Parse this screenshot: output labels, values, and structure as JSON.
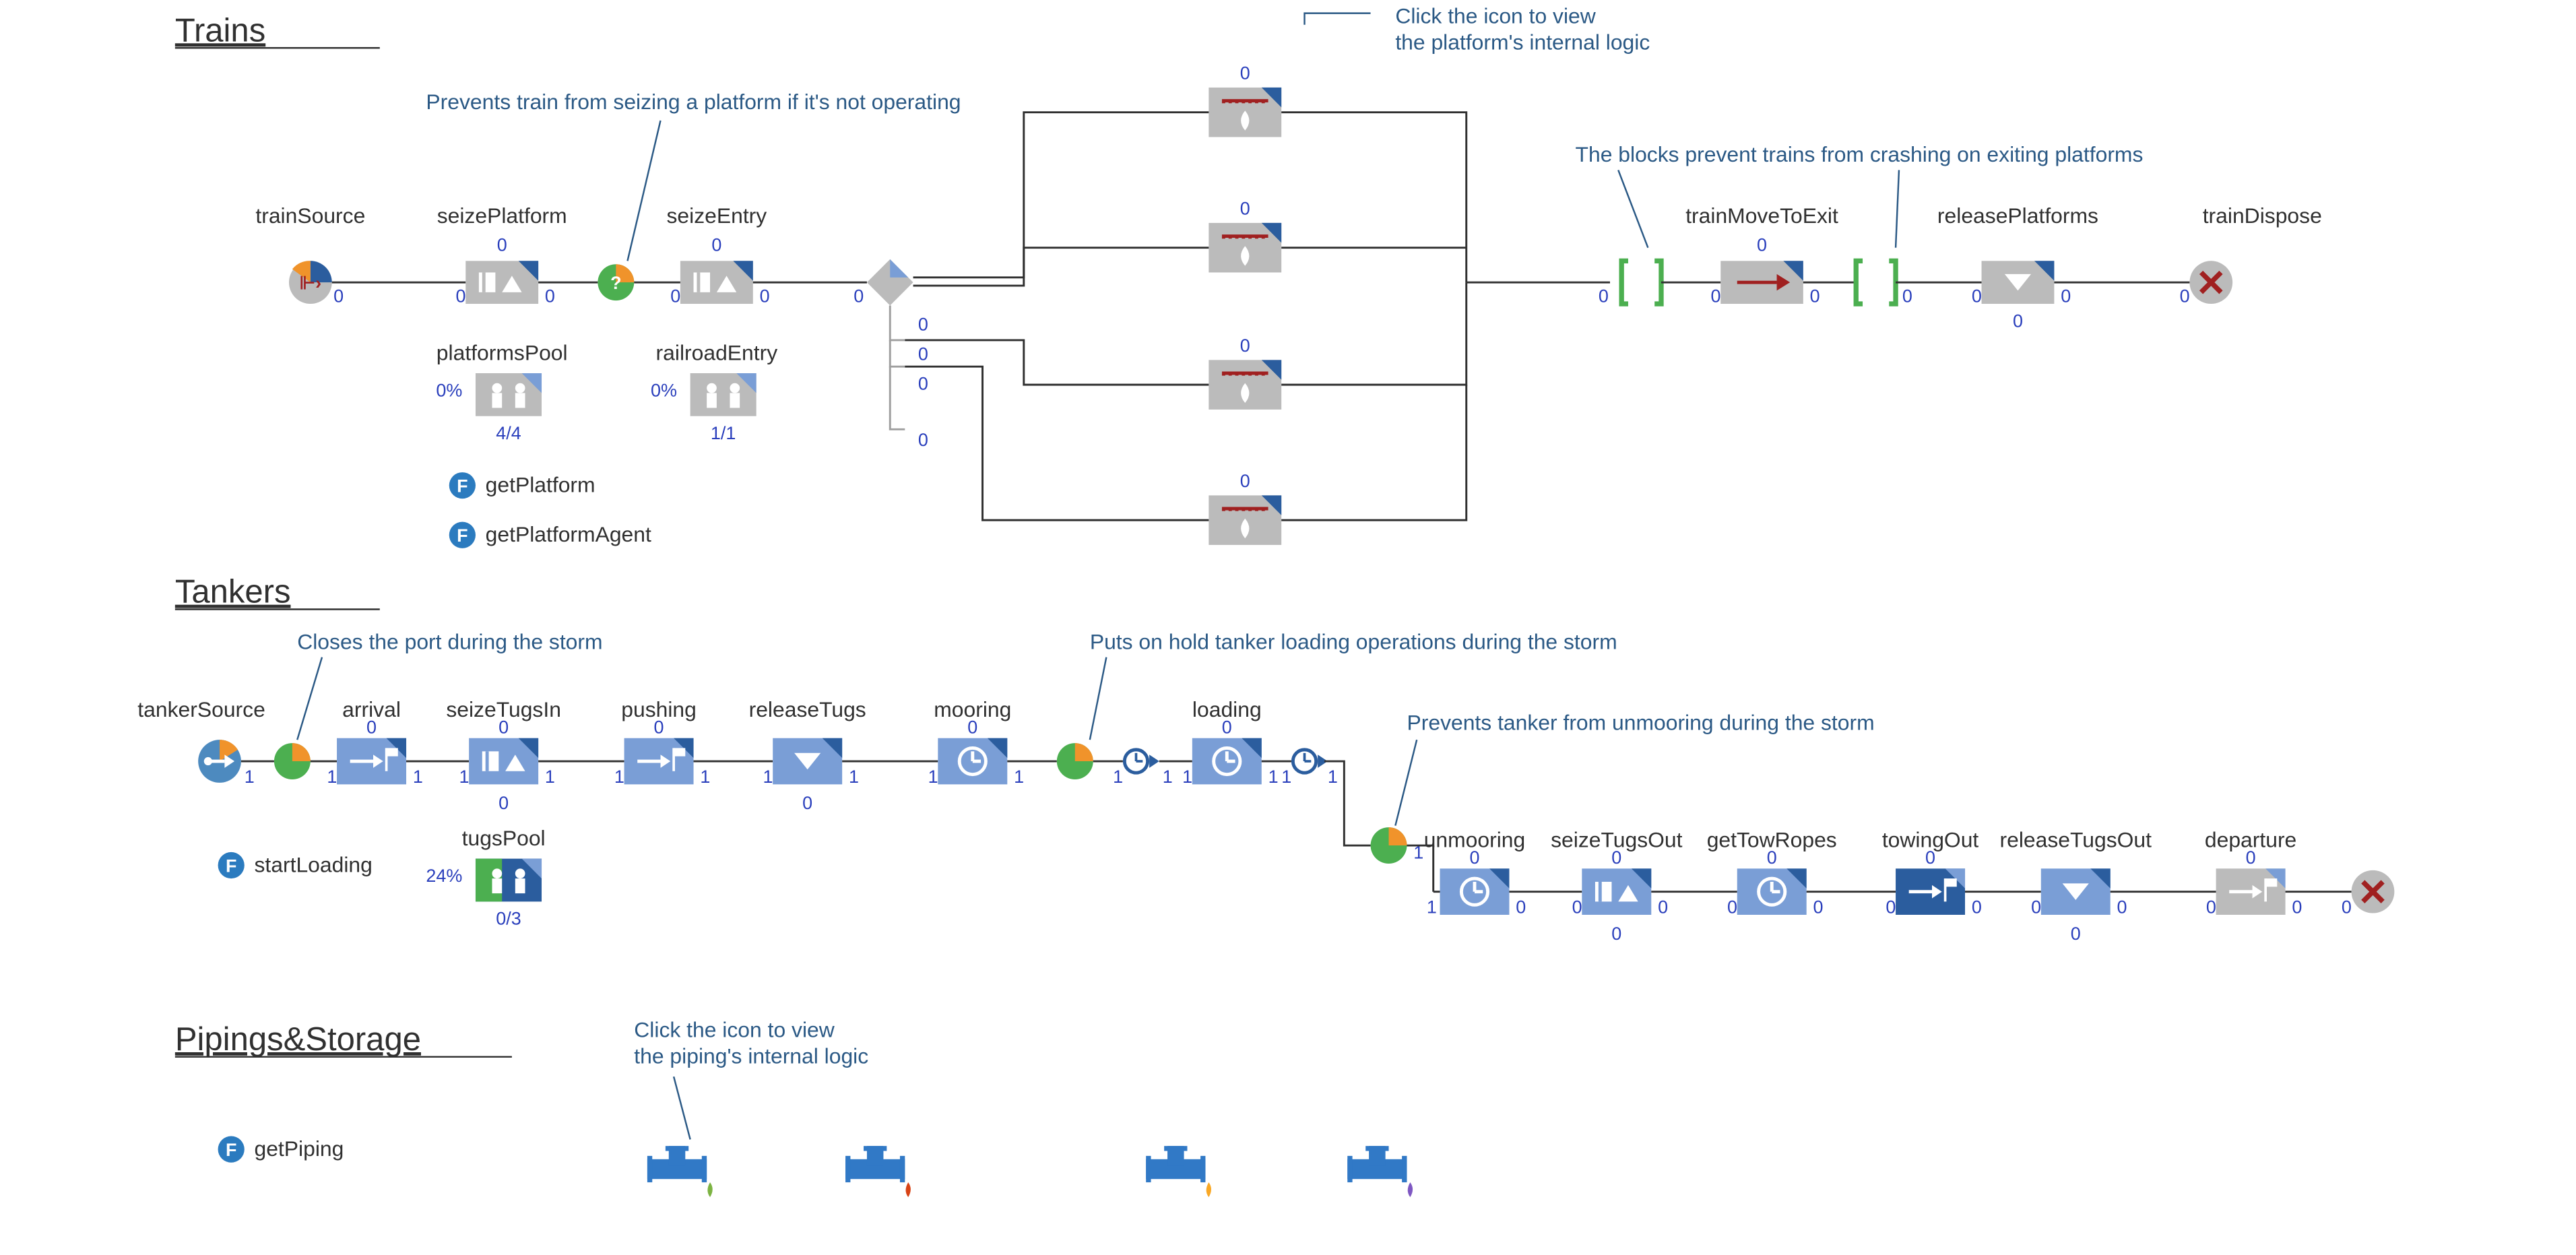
{
  "sections": {
    "trains": "Trains",
    "tankers": "Tankers",
    "pipings": "Pipings&Storage"
  },
  "notes": {
    "platformNote1": "Click the icon to view",
    "platformNote2": "the platform's internal logic",
    "preventPlatform": "Prevents train from seizing a platform if it's not operating",
    "blocksPrevent": "The blocks prevent trains from crashing on exiting platforms",
    "closesPort": "Closes the port during the storm",
    "putsOnHold": "Puts on hold tanker loading operations during the storm",
    "preventsUnmoor": "Prevents tanker from unmooring during the storm",
    "pipingNote1": "Click the icon to view",
    "pipingNote2": "the piping's internal logic"
  },
  "trains": {
    "source": {
      "label": "trainSource",
      "out": "0"
    },
    "seizePlatform": {
      "label": "seizePlatform",
      "top": "0",
      "in": "0",
      "out": "0"
    },
    "seizeEntry": {
      "label": "seizeEntry",
      "top": "0",
      "in": "0",
      "out": "0"
    },
    "selectOut": {
      "in": "0",
      "o1": "0",
      "o2": "0",
      "o3": "0",
      "o4": "0"
    },
    "platforms": [
      {
        "top": "0"
      },
      {
        "top": "0"
      },
      {
        "top": "0"
      },
      {
        "top": "0"
      }
    ],
    "restrict": {
      "in": "0",
      "out": "0"
    },
    "trainMoveToExit": {
      "label": "trainMoveToExit",
      "top": "0",
      "in": "0",
      "out": "0"
    },
    "releasePlatforms": {
      "label": "releasePlatforms",
      "in": "0",
      "out": "0",
      "bottom": "0"
    },
    "trainDispose": {
      "label": "trainDispose",
      "in": "0"
    },
    "platformsPool": {
      "label": "platformsPool",
      "pct": "0%",
      "ratio": "4/4"
    },
    "railroadEntry": {
      "label": "railroadEntry",
      "pct": "0%",
      "ratio": "1/1"
    },
    "funcs": [
      "getPlatform",
      "getPlatformAgent"
    ]
  },
  "tankers": {
    "source": {
      "label": "tankerSource",
      "out": "1"
    },
    "arrival": {
      "label": "arrival",
      "top": "0",
      "in": "1",
      "out": "1"
    },
    "seizeTugsIn": {
      "label": "seizeTugsIn",
      "top": "0",
      "in": "1",
      "out": "1",
      "bottom": "0"
    },
    "pushing": {
      "label": "pushing",
      "top": "0",
      "in": "1",
      "out": "1"
    },
    "releaseTugs": {
      "label": "releaseTugs",
      "in": "1",
      "out": "1",
      "bottom": "0"
    },
    "mooring": {
      "label": "mooring",
      "top": "0",
      "in": "1",
      "out": "1"
    },
    "hold1": {
      "in": "1",
      "out": "1"
    },
    "loading": {
      "label": "loading",
      "top": "0",
      "in": "1",
      "out": "1"
    },
    "hold2": {
      "in": "1",
      "out": "1"
    },
    "pie": {
      "in": "1"
    },
    "unmooring": {
      "label": "unmooring",
      "top": "0",
      "in": "1",
      "out": "0"
    },
    "seizeTugsOut": {
      "label": "seizeTugsOut",
      "top": "0",
      "in": "0",
      "out": "0",
      "bottom": "0"
    },
    "getTowRopes": {
      "label": "getTowRopes",
      "top": "0",
      "in": "0",
      "out": "0"
    },
    "towingOut": {
      "label": "towingOut",
      "top": "0",
      "in": "0",
      "out": "0"
    },
    "releaseTugsOut": {
      "label": "releaseTugsOut",
      "in": "0",
      "out": "0",
      "bottom": "0"
    },
    "departure": {
      "label": "departure",
      "top": "0",
      "in": "0",
      "out": "0"
    },
    "dispose": {
      "in": "0"
    },
    "tugsPool": {
      "label": "tugsPool",
      "pct": "24%",
      "ratio": "0/3"
    },
    "funcs": [
      "startLoading"
    ]
  },
  "pipings": {
    "funcs": [
      "getPiping"
    ]
  }
}
